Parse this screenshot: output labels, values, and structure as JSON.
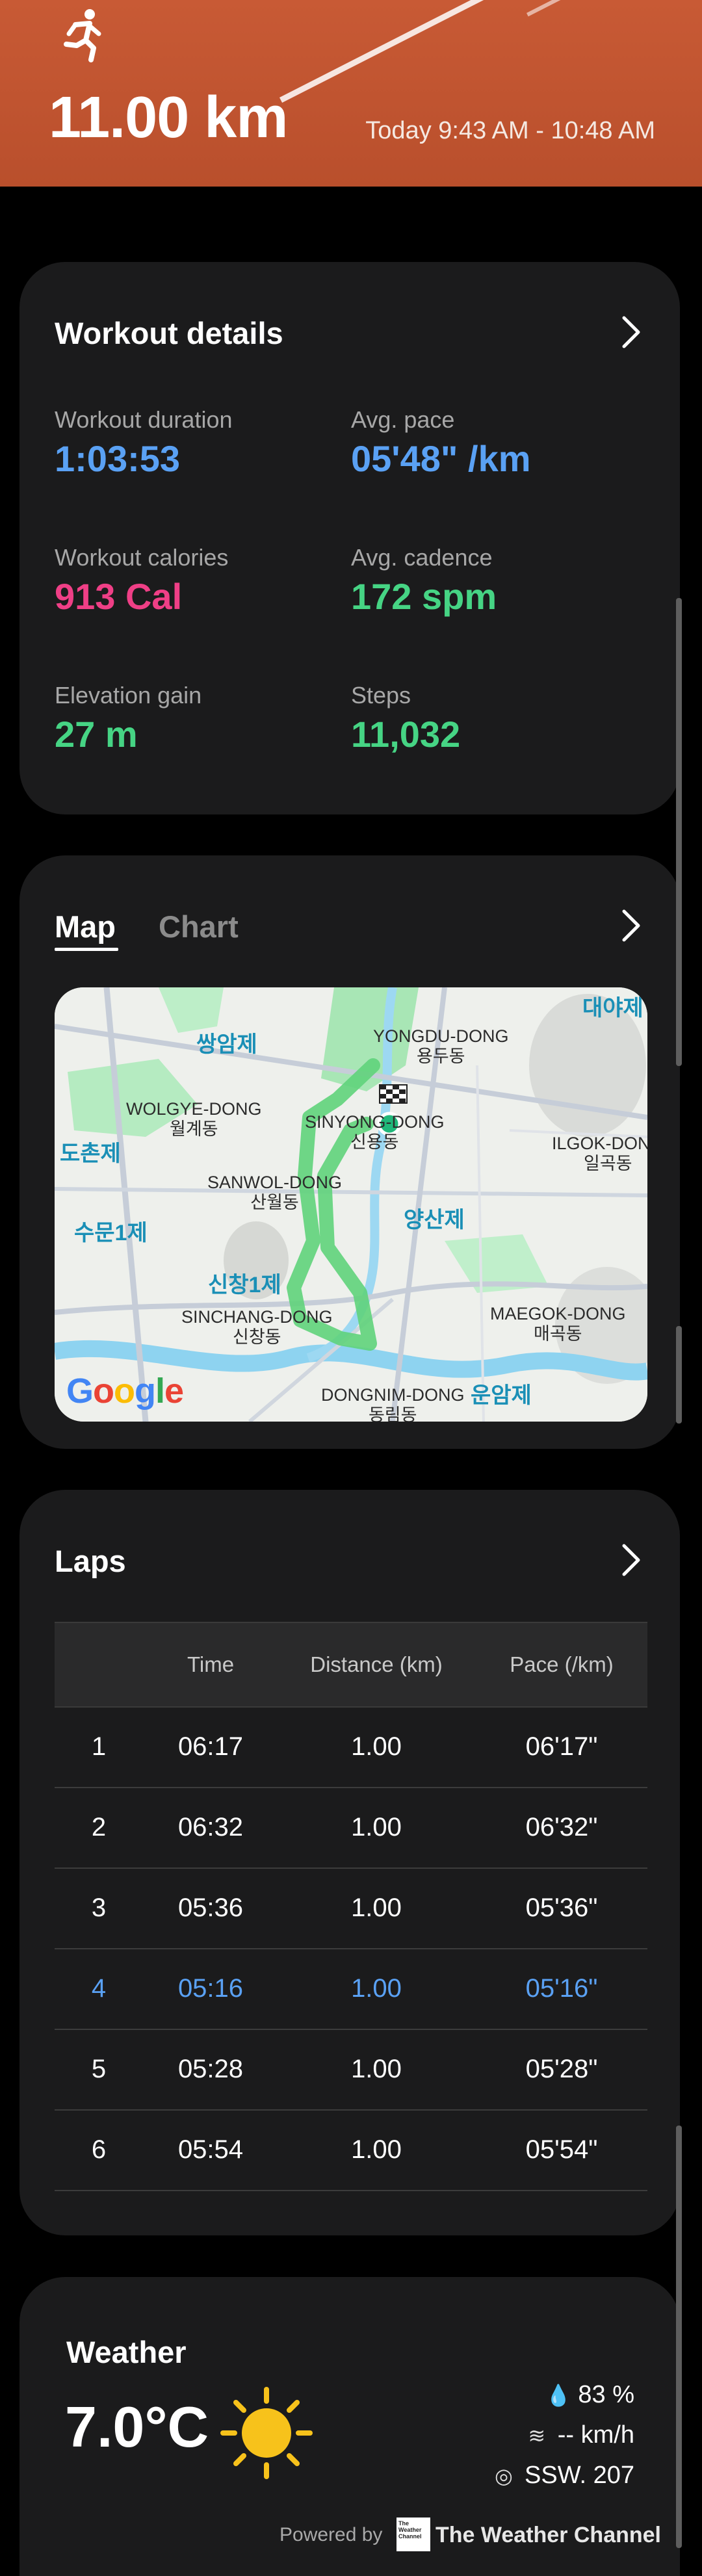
{
  "header": {
    "activity_icon": "running-person-icon",
    "distance": "11.00 km",
    "time_range": "Today 9:43 AM - 10:48 AM"
  },
  "workout_details": {
    "title": "Workout details",
    "stats": [
      {
        "label": "Workout duration",
        "value": "1:03:53",
        "color": "#5aa1f4"
      },
      {
        "label": "Avg. pace",
        "value": "05'48\" /km",
        "color": "#5aa1f4"
      },
      {
        "label": "Workout calories",
        "value": "913 Cal",
        "color": "#ef3f86"
      },
      {
        "label": "Avg. cadence",
        "value": "172 spm",
        "color": "#46d484"
      },
      {
        "label": "Elevation gain",
        "value": "27 m",
        "color": "#46d484"
      },
      {
        "label": "Steps",
        "value": "11,032",
        "color": "#46d484"
      }
    ]
  },
  "map_card": {
    "tabs": [
      "Map",
      "Chart"
    ],
    "active_tab": "Map",
    "labels": {
      "yongdu": "YONGDU-DONG\n용두동",
      "wolgye": "WOLGYE-DONG\n월계동",
      "sinyong": "SINYONG-DONG\n신용동",
      "ilgok": "ILGOK-DONG\n일곡동",
      "sanwol": "SANWOL-DONG\n산월동",
      "sinchang": "SINCHANG-DONG\n신창동",
      "maegok": "MAEGOK-DONG\n매곡동",
      "dongnim": "DONGNIM-DONG\n동림동"
    },
    "blue_labels": {
      "ssangam": "쌍암제",
      "daeya": "대야제",
      "dochon": "도촌제",
      "sumun": "수문1제",
      "yangsan": "양산제",
      "sinchang1": "신창1제",
      "unam": "운암제"
    },
    "attribution": "Google"
  },
  "laps": {
    "title": "Laps",
    "columns": [
      "",
      "Time",
      "Distance (km)",
      "Pace (/km)"
    ],
    "rows": [
      {
        "num": "1",
        "time": "06:17",
        "distance": "1.00",
        "pace": "06'17\"",
        "highlight": false
      },
      {
        "num": "2",
        "time": "06:32",
        "distance": "1.00",
        "pace": "06'32\"",
        "highlight": false
      },
      {
        "num": "3",
        "time": "05:36",
        "distance": "1.00",
        "pace": "05'36\"",
        "highlight": false
      },
      {
        "num": "4",
        "time": "05:16",
        "distance": "1.00",
        "pace": "05'16\"",
        "highlight": true
      },
      {
        "num": "5",
        "time": "05:28",
        "distance": "1.00",
        "pace": "05'28\"",
        "highlight": false
      },
      {
        "num": "6",
        "time": "05:54",
        "distance": "1.00",
        "pace": "05'54\"",
        "highlight": false
      }
    ],
    "highlight_color": "#5aa1f4"
  },
  "weather": {
    "title": "Weather",
    "temperature": "7.0°C",
    "condition_icon": "sun-icon",
    "humidity": "83 %",
    "wind_speed": "-- km/h",
    "wind_direction": "SSW. 207",
    "powered_by": "Powered by",
    "provider_logo_text": "The Weather Channel",
    "provider": "The Weather Channel"
  }
}
